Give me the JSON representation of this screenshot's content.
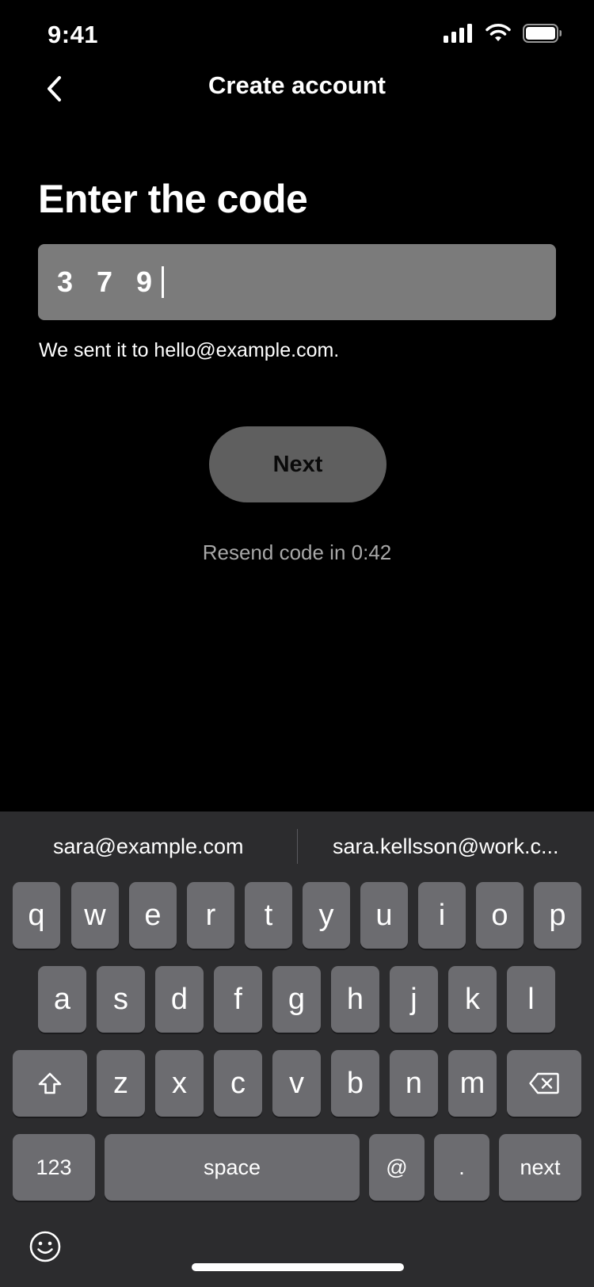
{
  "status": {
    "time": "9:41"
  },
  "nav": {
    "title": "Create account",
    "back_icon": "chevron-left-icon"
  },
  "heading": "Enter the code",
  "code_input": {
    "value": "3 7 9"
  },
  "helper_text": "We sent it to hello@example.com.",
  "next_button": {
    "label": "Next"
  },
  "resend_text": "Resend code in 0:42",
  "keyboard": {
    "suggestions": [
      "sara@example.com",
      "sara.kellsson@work.c..."
    ],
    "row1": [
      "q",
      "w",
      "e",
      "r",
      "t",
      "y",
      "u",
      "i",
      "o",
      "p"
    ],
    "row2": [
      "a",
      "s",
      "d",
      "f",
      "g",
      "h",
      "j",
      "k",
      "l"
    ],
    "row3": [
      "z",
      "x",
      "c",
      "v",
      "b",
      "n",
      "m"
    ],
    "bottom": {
      "numbers": "123",
      "space": "space",
      "at": "@",
      "dot": ".",
      "return": "next"
    },
    "icons": {
      "shift": "shift-icon",
      "delete": "delete-icon",
      "emoji": "emoji-icon"
    }
  },
  "colors": {
    "background": "#000000",
    "field": "#7b7b7b",
    "button": "#5f5f5f",
    "keyboard": "#2c2c2e",
    "key": "#6c6c70"
  }
}
